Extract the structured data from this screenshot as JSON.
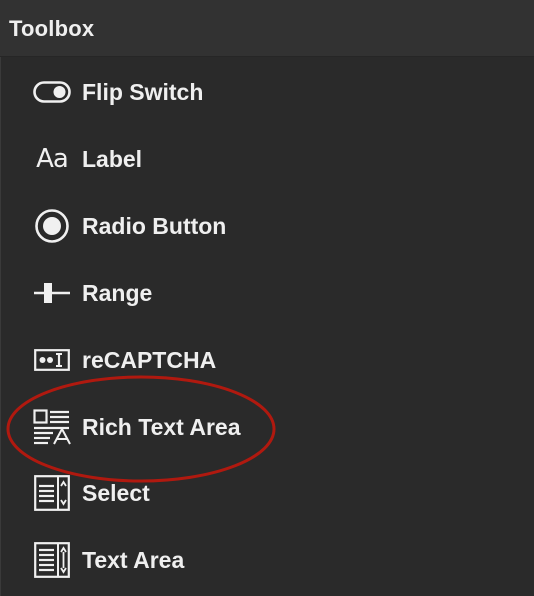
{
  "panel": {
    "title": "Toolbox"
  },
  "items": [
    {
      "label": "Flip Switch",
      "icon": "toggle-icon"
    },
    {
      "label": "Label",
      "icon": "label-aa-icon",
      "icon_text": "Aa"
    },
    {
      "label": "Radio Button",
      "icon": "radio-icon"
    },
    {
      "label": "Range",
      "icon": "range-slider-icon"
    },
    {
      "label": "reCAPTCHA",
      "icon": "recaptcha-icon"
    },
    {
      "label": "Rich Text Area",
      "icon": "rich-text-area-icon"
    },
    {
      "label": "Select",
      "icon": "select-icon"
    },
    {
      "label": "Text Area",
      "icon": "text-area-icon"
    }
  ],
  "annotation": {
    "shape": "ellipse",
    "color": "#b0190f",
    "target": "Rich Text Area"
  }
}
